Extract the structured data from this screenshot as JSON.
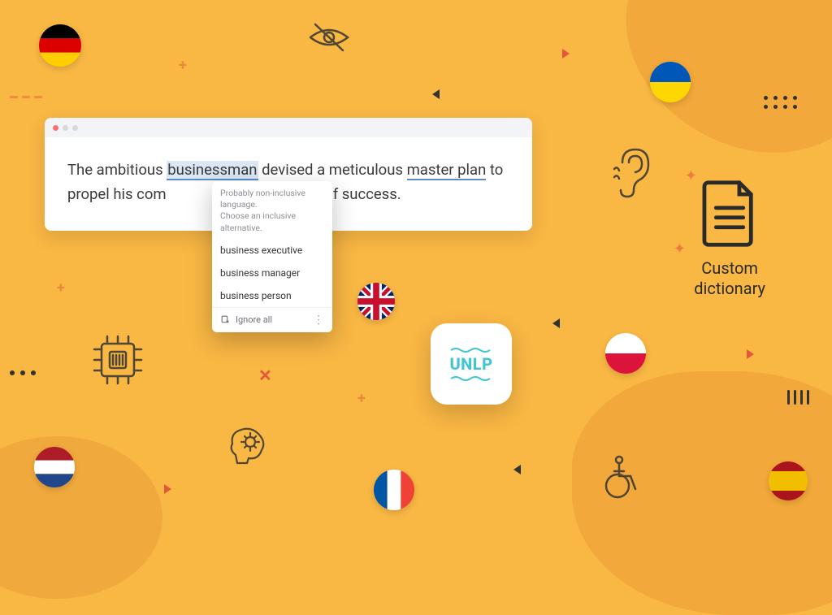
{
  "editor": {
    "text_before": "The ambitious ",
    "highlighted": "businessman",
    "text_mid1": " devised a meticulous ",
    "underlined": "master plan",
    "text_mid2": " to propel his com",
    "text_after": "ts of success."
  },
  "popup": {
    "title_line1": "Probably non-inclusive language.",
    "title_line2": "Choose an inclusive alternative.",
    "suggestions": [
      "business executive",
      "business manager",
      "business person"
    ],
    "ignore_label": "Ignore all"
  },
  "unlp": {
    "label": "UNLP"
  },
  "dictionary": {
    "line1": "Custom",
    "line2": "dictionary"
  },
  "flags": {
    "de": "Germany",
    "ua": "Ukraine",
    "uk": "United Kingdom",
    "pl": "Poland",
    "nl": "Netherlands",
    "fr": "France",
    "es": "Spain"
  },
  "icons": {
    "eye_off": "eye-crossed",
    "chip": "cpu-chip",
    "brain": "brain-idea",
    "ear": "ear",
    "wheelchair": "accessibility"
  }
}
